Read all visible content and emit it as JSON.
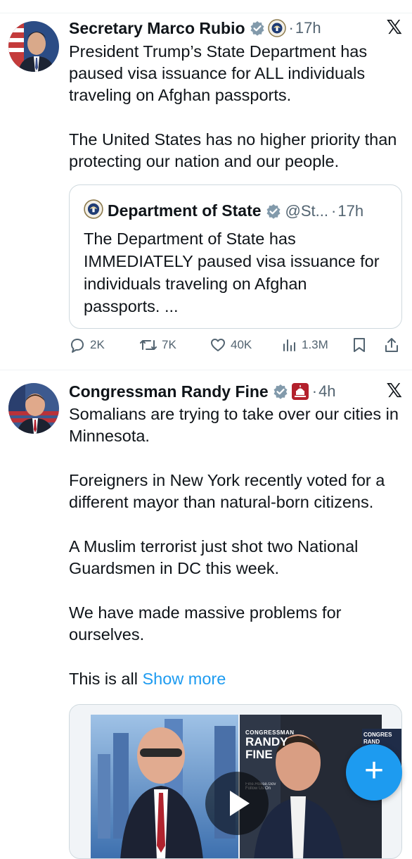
{
  "tweets": [
    {
      "author": "Secretary Marco Rubio",
      "time": "17h",
      "paragraphs": [
        "President Trump’s State Department has paused visa issuance for ALL individuals traveling on Afghan passports.",
        "The United States has no higher priority than protecting our nation and our people."
      ],
      "quote": {
        "author": "Department of State",
        "handle": "@St...",
        "time": "17h",
        "text": "The Department of State has IMMEDIATELY paused visa issuance for individuals traveling on Afghan passports. ..."
      },
      "actions": {
        "replies": "2K",
        "reposts": "7K",
        "likes": "40K",
        "views": "1.3M"
      }
    },
    {
      "author": "Congressman Randy Fine",
      "time": "4h",
      "paragraphs": [
        "Somalians are trying to take over our cities in Minnesota.",
        "Foreigners in New York recently voted for a different mayor than natural-born citizens.",
        "A Muslim terrorist just shot two National Guardsmen in DC this week.",
        "We have made massive problems for ourselves."
      ],
      "last_line": "This is all",
      "show_more": "Show more",
      "media": {
        "banner_line1": "CONGRESSMAN",
        "banner_line2": "RANDY",
        "banner_line3": "FINE",
        "banner_small": "Fine.House.Gov Follow Us On",
        "right_banner": "CONGRES RAND"
      }
    }
  ],
  "ui": {
    "x_logo": "𝕏",
    "separator_dot": "·",
    "fab_label": "+"
  },
  "colors": {
    "accent": "#1d9bf0",
    "muted": "#536471",
    "verified": "#829aab"
  }
}
